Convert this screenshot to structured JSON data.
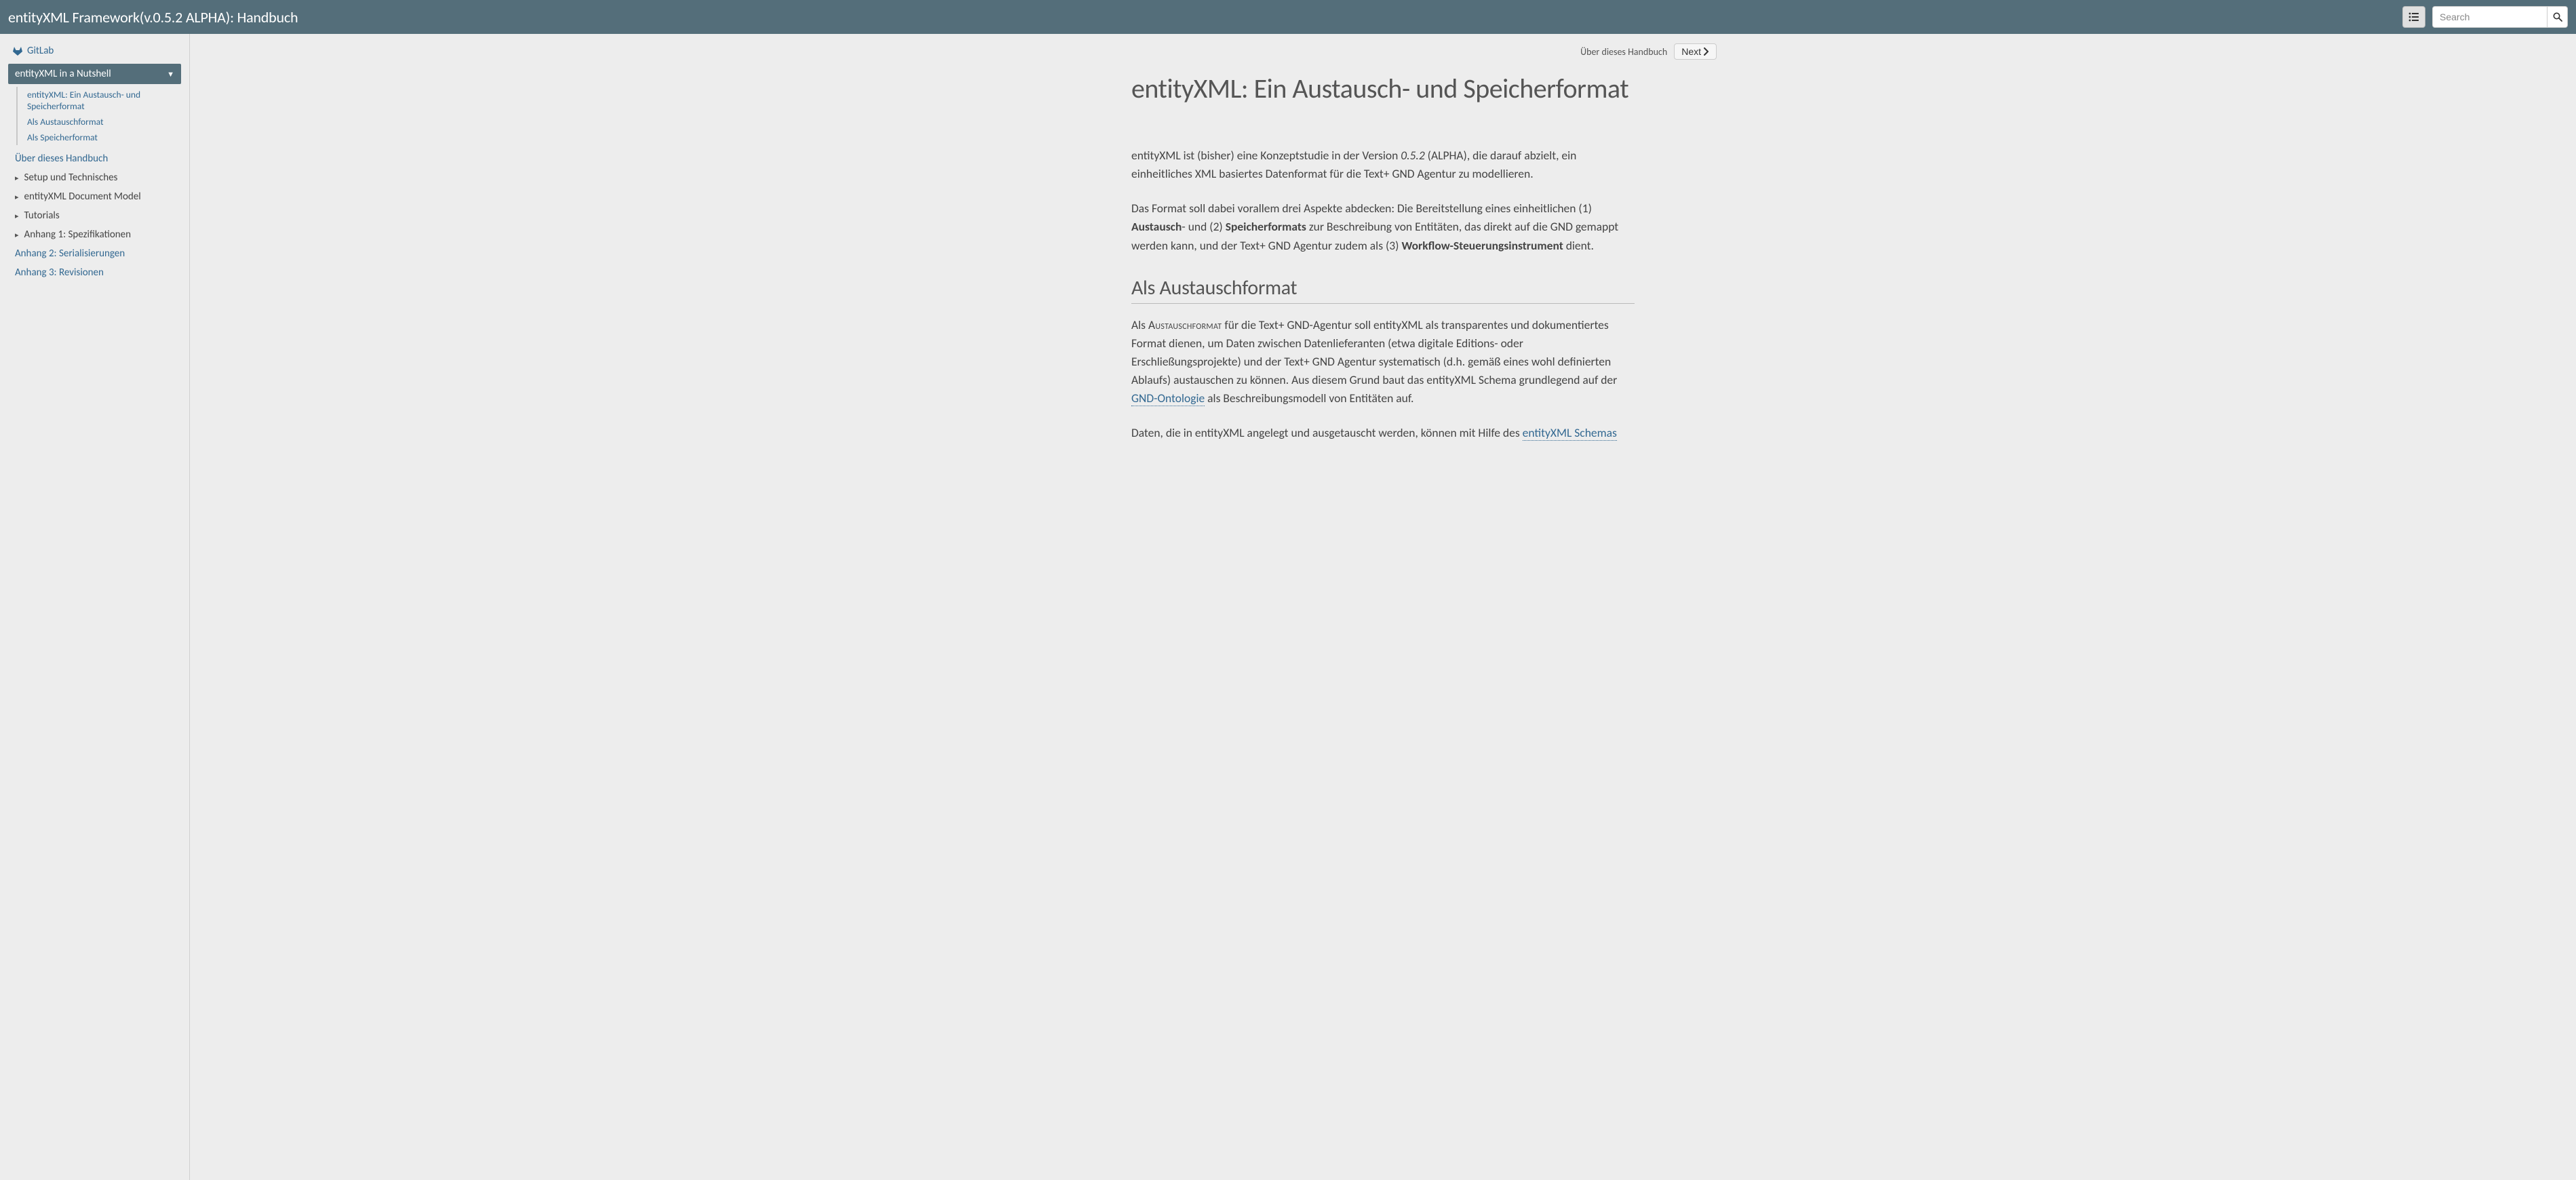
{
  "header": {
    "title": "entityXML Framework(v.0.5.2 ALPHA): Handbuch",
    "search_placeholder": "Search"
  },
  "topnav": {
    "context": "Über dieses Handbuch",
    "next": "Next"
  },
  "sidebar": {
    "gitlab": "GitLab",
    "active": "entityXML in a Nutshell",
    "sub": [
      "entityXML: Ein Austausch- und Speicherformat",
      "Als Austauschformat",
      "Als Speicherformat"
    ],
    "items": [
      {
        "label": "Über dieses Handbuch",
        "caret": false,
        "blue": true
      },
      {
        "label": "Setup und Technisches",
        "caret": true
      },
      {
        "label": "entityXML Document Model",
        "caret": true
      },
      {
        "label": "Tutorials",
        "caret": true
      },
      {
        "label": "Anhang 1: Spezifikationen",
        "caret": true
      },
      {
        "label": "Anhang 2: Serialisierungen",
        "caret": false,
        "blue": true
      },
      {
        "label": "Anhang 3: Revisionen",
        "caret": false,
        "blue": true
      }
    ]
  },
  "article": {
    "h1": "entityXML: Ein Austausch- und Speicherformat",
    "p1_a": "entityXML ist (bisher) eine Konzeptstudie in der Version ",
    "p1_em": "0.5.2",
    "p1_b": " (ALPHA), die darauf abzielt, ein einheitliches XML basiertes Datenformat für die Text+ GND Agentur zu modellieren.",
    "p2_a": "Das Format soll dabei vorallem drei Aspekte abdecken: Die Bereitstellung eines einheitlichen (1) ",
    "p2_s1": "Austausch",
    "p2_b": "- und (2) ",
    "p2_s2": "Speicherformats",
    "p2_c": " zur Beschreibung von Entitäten, das direkt auf die GND gemappt werden kann, und der Text+ GND Agentur zudem als (3) ",
    "p2_s3": "Workflow-Steuerungsinstrument",
    "p2_d": " dient.",
    "h2": "Als Austauschformat",
    "p3_a": "Als ",
    "p3_sc": "Austauschformat",
    "p3_b": " für die Text+ GND-Agentur soll entityXML als transparentes und dokumentiertes Format dienen, um Daten zwischen Datenlieferanten (etwa digitale Editions- oder Erschließungsprojekte) und der Text+ GND Agentur systematisch (d.h. gemäß eines wohl definierten Ablaufs) austauschen zu können. Aus diesem Grund baut das entityXML Schema grundlegend auf der ",
    "p3_link1": "GND-Ontologie",
    "p3_c": " als Beschreibungsmodell von Entitäten auf.",
    "p4_a": "Daten, die in entityXML angelegt und ausgetauscht werden, können mit Hilfe des ",
    "p4_link1": "entityXML Schemas"
  }
}
